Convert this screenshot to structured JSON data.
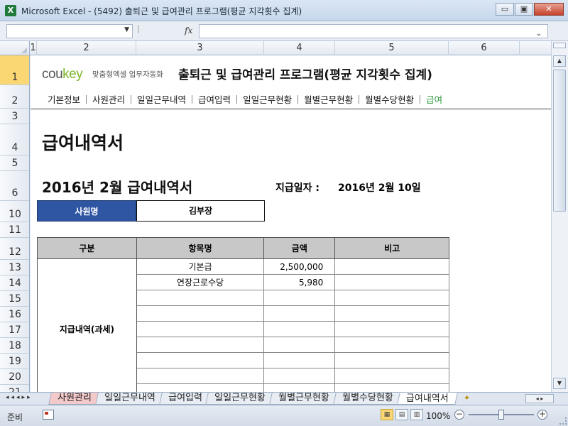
{
  "window": {
    "title": "Microsoft Excel - (5492) 출퇴근 및 급여관리 프로그램(평균 지각횟수 집계)",
    "app_icon": "X",
    "minimize": "▭",
    "restore": "▣",
    "close": "✕"
  },
  "formula_bar": {
    "name_box": "",
    "fx_label": "fx",
    "formula": ""
  },
  "columns": [
    "1",
    "2",
    "3",
    "4",
    "5",
    "6"
  ],
  "rows": [
    "1",
    "2",
    "3",
    "4",
    "5",
    "6",
    "10",
    "11",
    "12",
    "13",
    "14",
    "15",
    "16",
    "17",
    "18",
    "19",
    "20",
    "21"
  ],
  "sheet": {
    "logo_main": "cou",
    "logo_key": "key",
    "logo_sub": "맞춤형엑셀 업무자동화",
    "app_title": "출퇴근 및 급여관리 프로그램(평균 지각횟수 집계)",
    "menu": [
      "기본정보",
      "사원관리",
      "일일근무내역",
      "급여입력",
      "일일근무현황",
      "월별근무현황",
      "월별수당현황",
      "급여"
    ],
    "doc_title": "급여내역서",
    "pay_title": "2016년 2월  급여내역서",
    "pay_date_label": "지급일자 :",
    "pay_date": "2016년 2월 10일",
    "employee_label": "사원명",
    "employee_name": "김부장",
    "table": {
      "headers": [
        "구분",
        "항목명",
        "금액",
        "비고"
      ],
      "category": "지급내역(과세)",
      "items": [
        {
          "name": "기본급",
          "amount": "2,500,000",
          "note": ""
        },
        {
          "name": "연장근로수당",
          "amount": "5,980",
          "note": ""
        },
        {
          "name": "",
          "amount": "",
          "note": ""
        },
        {
          "name": "",
          "amount": "",
          "note": ""
        },
        {
          "name": "",
          "amount": "",
          "note": ""
        },
        {
          "name": "",
          "amount": "",
          "note": ""
        },
        {
          "name": "",
          "amount": "",
          "note": ""
        },
        {
          "name": "",
          "amount": "",
          "note": ""
        },
        {
          "name": "",
          "amount": "",
          "note": ""
        }
      ]
    }
  },
  "sheet_tabs": {
    "nav": "◂◂◂▸▸",
    "tabs": [
      "사원관리",
      "일일근무내역",
      "급여입력",
      "일일근무현황",
      "월별근무현황",
      "월별수당현황",
      "급여내역서"
    ],
    "active": "급여내역서"
  },
  "status": {
    "ready": "준비",
    "zoom": "100%"
  },
  "colors": {
    "accent_blue": "#2f56a3",
    "logo_green": "#7bb52a",
    "active_menu": "#2b9a3c",
    "header_gray": "#c8c8c8"
  }
}
